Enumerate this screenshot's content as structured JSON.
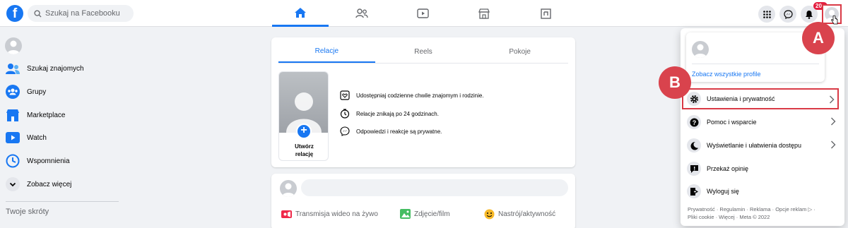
{
  "search": {
    "placeholder": "Szukaj na Facebooku"
  },
  "notifications": {
    "count": "20+"
  },
  "sidebar": {
    "items": [
      {
        "label": "Szukaj znajomych"
      },
      {
        "label": "Grupy"
      },
      {
        "label": "Marketplace"
      },
      {
        "label": "Watch"
      },
      {
        "label": "Wspomnienia"
      },
      {
        "label": "Zobacz więcej"
      }
    ],
    "shortcuts_heading": "Twoje skróty"
  },
  "stories": {
    "tabs": [
      "Relacje",
      "Reels",
      "Pokoje"
    ],
    "create_label_1": "Utwórz",
    "create_label_2": "relację",
    "lines": [
      "Udostępniaj codzienne chwile znajomym i rodzinie.",
      "Relacje znikają po 24 godzinach.",
      "Odpowiedzi i reakcje są prywatne."
    ]
  },
  "composer": {
    "actions": [
      "Transmisja wideo na żywo",
      "Zdjęcie/film",
      "Nastrój/aktywność"
    ]
  },
  "menu": {
    "see_all_profiles": "Zobacz wszystkie profile",
    "items": [
      {
        "label": "Ustawienia i prywatność"
      },
      {
        "label": "Pomoc i wsparcie"
      },
      {
        "label": "Wyświetlanie i ułatwienia dostępu"
      },
      {
        "label": "Przekaż opinię"
      },
      {
        "label": "Wyloguj się"
      }
    ],
    "footer_line1": "Prywatność · Regulamin · Reklama · Opcje reklam ▷ ·",
    "footer_line2": "Pliki cookie · Więcej · Meta © 2022"
  },
  "annotations": {
    "a": "A",
    "b": "B"
  },
  "colors": {
    "accent": "#1877f2",
    "annotation": "#d9434d"
  }
}
